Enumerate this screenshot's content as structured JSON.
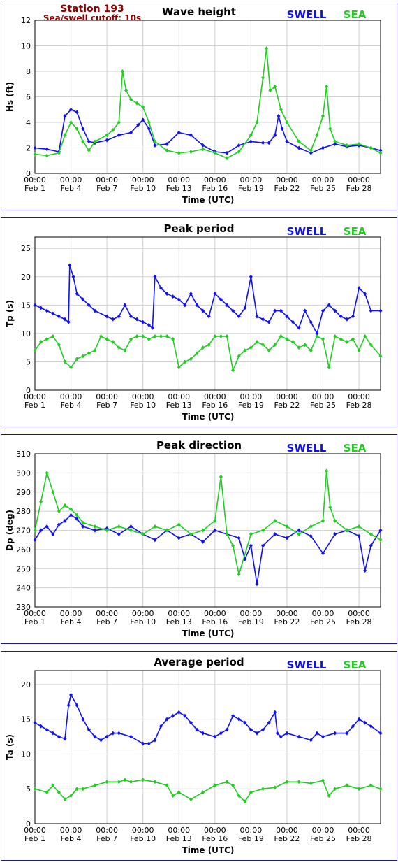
{
  "header": {
    "station": "Station 193",
    "cutoff": "Sea/swell cutoff: 10s",
    "color": "#8b0000"
  },
  "legend": {
    "swell_label": "SWELL",
    "sea_label": "SEA",
    "swell_color": "#1111ee",
    "sea_color": "#22cc22"
  },
  "x_ticks": [
    {
      "line1": "00:00",
      "line2": "Feb 1",
      "day": 1
    },
    {
      "line1": "00:00",
      "line2": "Feb 4",
      "day": 4
    },
    {
      "line1": "00:00",
      "line2": "Feb 7",
      "day": 7
    },
    {
      "line1": "00:00",
      "line2": "Feb 10",
      "day": 10
    },
    {
      "line1": "00:00",
      "line2": "Feb 13",
      "day": 13
    },
    {
      "line1": "00:00",
      "line2": "Feb 16",
      "day": 16
    },
    {
      "line1": "00:00",
      "line2": "Feb 19",
      "day": 19
    },
    {
      "line1": "00:00",
      "line2": "Feb 22",
      "day": 22
    },
    {
      "line1": "00:00",
      "line2": "Feb 25",
      "day": 25
    },
    {
      "line1": "00:00",
      "line2": "Feb 28",
      "day": 28
    }
  ],
  "chart_data": [
    {
      "type": "line",
      "title": "Wave height",
      "xlabel": "Time (UTC)",
      "ylabel": "Hs (ft)",
      "ylim": [
        0,
        12
      ],
      "yticks": [
        0,
        2,
        4,
        6,
        8,
        10,
        12
      ],
      "xlim": [
        1,
        29.8
      ],
      "grid": true,
      "legend_position": "top-right",
      "series": [
        {
          "name": "SWELL",
          "color": "#1111ee",
          "x": [
            1,
            2,
            3,
            3.5,
            4,
            4.5,
            5,
            5.5,
            6,
            7,
            8,
            9,
            9.6,
            10,
            10.5,
            11,
            12,
            13,
            14,
            15,
            16,
            17,
            18,
            19,
            20,
            20.5,
            21,
            21.3,
            21.6,
            22,
            23,
            24,
            25,
            26,
            27,
            28,
            29,
            29.8
          ],
          "y": [
            2.0,
            1.9,
            1.7,
            4.5,
            5.0,
            4.8,
            3.5,
            2.5,
            2.4,
            2.6,
            3.0,
            3.2,
            3.8,
            4.2,
            3.5,
            2.2,
            2.3,
            3.2,
            3.0,
            2.2,
            1.7,
            1.6,
            2.2,
            2.5,
            2.4,
            2.4,
            3.0,
            4.5,
            3.5,
            2.5,
            2.0,
            1.6,
            2.0,
            2.3,
            2.1,
            2.2,
            2.0,
            1.8
          ]
        },
        {
          "name": "SEA",
          "color": "#22cc22",
          "x": [
            1,
            2,
            3,
            3.5,
            4,
            4.5,
            5,
            5.5,
            6,
            7,
            7.5,
            8,
            8.3,
            8.6,
            9,
            9.5,
            10,
            10.5,
            11,
            12,
            13,
            14,
            15,
            16,
            17,
            18,
            19,
            19.5,
            20,
            20.3,
            20.6,
            21,
            21.5,
            22,
            23,
            24,
            24.5,
            25,
            25.3,
            25.6,
            26,
            27,
            28,
            29,
            29.8
          ],
          "y": [
            1.5,
            1.4,
            1.6,
            3.0,
            4.0,
            3.5,
            2.5,
            1.8,
            2.5,
            3.0,
            3.4,
            4.0,
            8.0,
            6.5,
            5.8,
            5.5,
            5.2,
            4.0,
            2.5,
            1.8,
            1.6,
            1.7,
            1.9,
            1.6,
            1.2,
            1.7,
            3.0,
            4.0,
            7.5,
            9.8,
            6.5,
            6.8,
            5.0,
            4.0,
            2.5,
            1.8,
            3.0,
            4.5,
            6.8,
            3.5,
            2.5,
            2.2,
            2.3,
            2.0,
            1.6
          ]
        }
      ]
    },
    {
      "type": "line",
      "title": "Peak period",
      "xlabel": "Time (UTC)",
      "ylabel": "Tp (s)",
      "ylim": [
        0,
        27
      ],
      "yticks": [
        0,
        5,
        10,
        15,
        20,
        25
      ],
      "xlim": [
        1,
        29.8
      ],
      "grid": true,
      "legend_position": "top-right",
      "series": [
        {
          "name": "SWELL",
          "color": "#1111ee",
          "x": [
            1,
            1.5,
            2,
            2.5,
            3,
            3.5,
            3.8,
            3.9,
            4.2,
            4.5,
            5,
            5.5,
            6,
            7,
            7.5,
            8,
            8.5,
            9,
            9.5,
            10,
            10.5,
            10.8,
            11,
            11.5,
            12,
            12.5,
            13,
            13.5,
            14,
            14.5,
            15,
            15.5,
            16,
            16.5,
            17,
            17.5,
            18,
            18.5,
            19,
            19.5,
            20,
            20.5,
            21,
            21.5,
            22,
            22.5,
            23,
            23.5,
            24,
            24.5,
            25,
            25.5,
            26,
            26.5,
            27,
            27.5,
            28,
            28.5,
            29,
            29.8
          ],
          "y": [
            15,
            14.5,
            14,
            13.5,
            13,
            12.5,
            12,
            22,
            20,
            17,
            16,
            15,
            14,
            13,
            12.5,
            13,
            15,
            13,
            12.5,
            12,
            11.5,
            11,
            20,
            18,
            17,
            16.5,
            16,
            15,
            17,
            15,
            14,
            13,
            17,
            16,
            15,
            14,
            13,
            14.5,
            20,
            13,
            12.5,
            12,
            14,
            14,
            13,
            12,
            11,
            14,
            12,
            10,
            14,
            15,
            14,
            13,
            12.5,
            13,
            18,
            17,
            14,
            14
          ]
        },
        {
          "name": "SEA",
          "color": "#22cc22",
          "x": [
            1,
            1.5,
            2,
            2.5,
            3,
            3.5,
            4,
            4.5,
            5,
            5.5,
            6,
            6.5,
            7,
            7.5,
            8,
            8.5,
            9,
            9.5,
            10,
            10.5,
            11,
            11.5,
            12,
            12.5,
            13,
            13.5,
            14,
            14.5,
            15,
            15.5,
            16,
            16.5,
            17,
            17.5,
            18,
            18.5,
            19,
            19.5,
            20,
            20.5,
            21,
            21.5,
            22,
            22.5,
            23,
            23.5,
            24,
            24.5,
            25,
            25.5,
            26,
            26.5,
            27,
            27.5,
            28,
            28.5,
            29,
            29.8
          ],
          "y": [
            7,
            8.5,
            9,
            9.5,
            8,
            5,
            4,
            5.5,
            6,
            6.5,
            7,
            9.5,
            9,
            8.5,
            7.5,
            7,
            9,
            9.5,
            9.5,
            9,
            9.5,
            9.5,
            9.5,
            9,
            4,
            5,
            5.5,
            6.5,
            7.5,
            8,
            9.5,
            9.5,
            9.5,
            3.5,
            6,
            7,
            7.5,
            8.5,
            8,
            7,
            8,
            9.5,
            9,
            8.5,
            7.5,
            8,
            7,
            9.5,
            9,
            4,
            9.5,
            9,
            8.5,
            9,
            7,
            9.5,
            8,
            6
          ]
        }
      ]
    },
    {
      "type": "line",
      "title": "Peak direction",
      "xlabel": "Time (UTC)",
      "ylabel": "Dp (deg)",
      "ylim": [
        230,
        310
      ],
      "yticks": [
        230,
        240,
        250,
        260,
        270,
        280,
        290,
        300,
        310
      ],
      "xlim": [
        1,
        29.8
      ],
      "grid": true,
      "legend_position": "top-right",
      "series": [
        {
          "name": "SWELL",
          "color": "#1111ee",
          "x": [
            1,
            1.5,
            2,
            2.5,
            3,
            3.5,
            4,
            4.5,
            5,
            6,
            7,
            8,
            9,
            10,
            11,
            12,
            13,
            14,
            15,
            16,
            17,
            18,
            18.5,
            19,
            19.5,
            20,
            21,
            22,
            23,
            24,
            25,
            26,
            27,
            28,
            28.5,
            29,
            29.8
          ],
          "y": [
            265,
            270,
            272,
            268,
            273,
            275,
            278,
            276,
            272,
            270,
            271,
            268,
            272,
            268,
            265,
            270,
            266,
            268,
            264,
            270,
            268,
            266,
            255,
            262,
            242,
            262,
            268,
            266,
            270,
            267,
            258,
            268,
            270,
            267,
            249,
            262,
            270
          ]
        },
        {
          "name": "SEA",
          "color": "#22cc22",
          "x": [
            1,
            1.5,
            2,
            2.5,
            3,
            3.5,
            4,
            4.5,
            5,
            6,
            7,
            8,
            9,
            10,
            11,
            12,
            13,
            14,
            15,
            16,
            16.5,
            17,
            17.5,
            18,
            19,
            20,
            21,
            22,
            23,
            24,
            25,
            25.3,
            25.6,
            26,
            27,
            28,
            29,
            29.8
          ],
          "y": [
            270,
            285,
            300,
            290,
            280,
            283,
            281,
            278,
            274,
            272,
            270,
            272,
            270,
            268,
            272,
            270,
            273,
            268,
            270,
            275,
            298,
            268,
            262,
            247,
            268,
            270,
            275,
            272,
            268,
            272,
            275,
            301,
            282,
            275,
            270,
            272,
            268,
            265
          ]
        }
      ]
    },
    {
      "type": "line",
      "title": "Average period",
      "xlabel": "Time (UTC)",
      "ylabel": "Ta (s)",
      "ylim": [
        0,
        22
      ],
      "yticks": [
        0,
        5,
        10,
        15,
        20
      ],
      "xlim": [
        1,
        29.8
      ],
      "grid": true,
      "legend_position": "top-right",
      "series": [
        {
          "name": "SWELL",
          "color": "#1111ee",
          "x": [
            1,
            1.5,
            2,
            2.5,
            3,
            3.5,
            3.8,
            4,
            4.5,
            5,
            5.5,
            6,
            6.5,
            7,
            7.5,
            8,
            9,
            10,
            10.5,
            11,
            11.5,
            12,
            12.5,
            13,
            13.5,
            14,
            14.5,
            15,
            16,
            16.5,
            17,
            17.5,
            18,
            18.5,
            19,
            19.5,
            20,
            20.5,
            21,
            21.2,
            21.5,
            22,
            23,
            24,
            24.5,
            25,
            26,
            27,
            27.5,
            28,
            28.5,
            29,
            29.8
          ],
          "y": [
            14.5,
            14,
            13.5,
            13,
            12.5,
            12.2,
            17,
            18.5,
            17,
            15,
            13.5,
            12.5,
            12,
            12.5,
            13,
            13,
            12.5,
            11.5,
            11.5,
            12,
            14,
            15,
            15.5,
            16,
            15.5,
            14.5,
            13.5,
            13,
            12.5,
            13,
            13.5,
            15.5,
            15,
            14.5,
            13.5,
            13,
            13.5,
            14.5,
            16,
            13,
            12.5,
            13,
            12.5,
            12,
            13,
            12.5,
            13,
            13,
            14,
            15,
            14.5,
            14,
            13
          ]
        },
        {
          "name": "SEA",
          "color": "#22cc22",
          "x": [
            1,
            2,
            2.5,
            3,
            3.5,
            4,
            4.5,
            5,
            6,
            7,
            8,
            8.5,
            9,
            10,
            11,
            12,
            12.5,
            13,
            14,
            15,
            16,
            17,
            17.5,
            18,
            18.5,
            19,
            20,
            21,
            22,
            23,
            24,
            25,
            25.5,
            26,
            27,
            28,
            29,
            29.8
          ],
          "y": [
            5,
            4.5,
            5.5,
            4.5,
            3.5,
            4,
            5,
            5,
            5.5,
            6,
            6,
            6.3,
            6,
            6.3,
            6,
            5.5,
            4,
            4.5,
            3.5,
            4.5,
            5.5,
            6,
            5.5,
            4,
            3.2,
            4.5,
            5,
            5.2,
            6,
            6,
            5.8,
            6.2,
            4,
            5,
            5.5,
            5,
            5.5,
            5
          ]
        }
      ]
    }
  ]
}
